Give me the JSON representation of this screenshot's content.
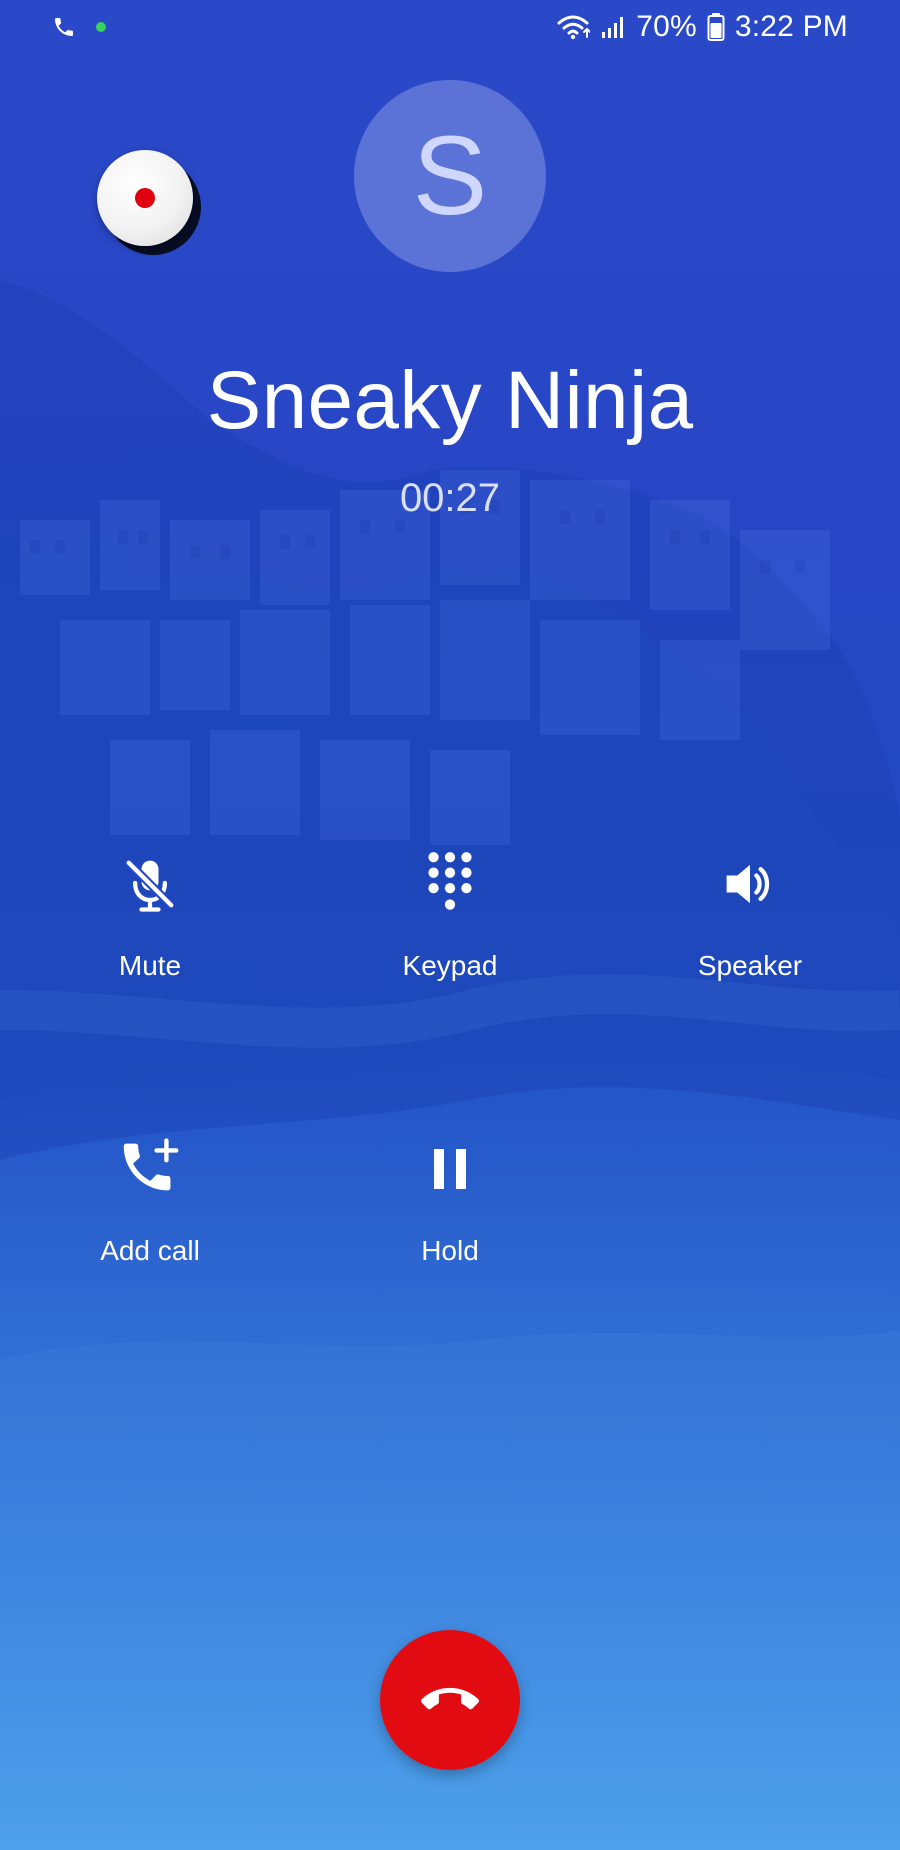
{
  "status_bar": {
    "left_icons": [
      "phone-icon",
      "green-dot-icon"
    ],
    "battery": "70%",
    "time": "3:22 PM",
    "right_icons": [
      "wifi-icon",
      "signal-icon",
      "battery-icon"
    ]
  },
  "recorder": {
    "icon": "record-icon"
  },
  "caller": {
    "avatar_initial": "S",
    "name": "Sneaky Ninja",
    "duration": "00:27"
  },
  "controls": {
    "mute": {
      "label": "Mute",
      "icon": "mic-off-icon"
    },
    "keypad": {
      "label": "Keypad",
      "icon": "keypad-icon"
    },
    "speaker": {
      "label": "Speaker",
      "icon": "speaker-icon"
    },
    "add_call": {
      "label": "Add call",
      "icon": "add-call-icon"
    },
    "hold": {
      "label": "Hold",
      "icon": "pause-icon"
    }
  },
  "end_call": {
    "icon": "end-call-icon"
  },
  "colors": {
    "background": "#2746c6",
    "background_bottom": "#3a93e6",
    "end_call": "#e30b12",
    "record_dot": "#e00010",
    "status_dot": "#39d15a",
    "avatar_bg": "#7a8cdf"
  }
}
